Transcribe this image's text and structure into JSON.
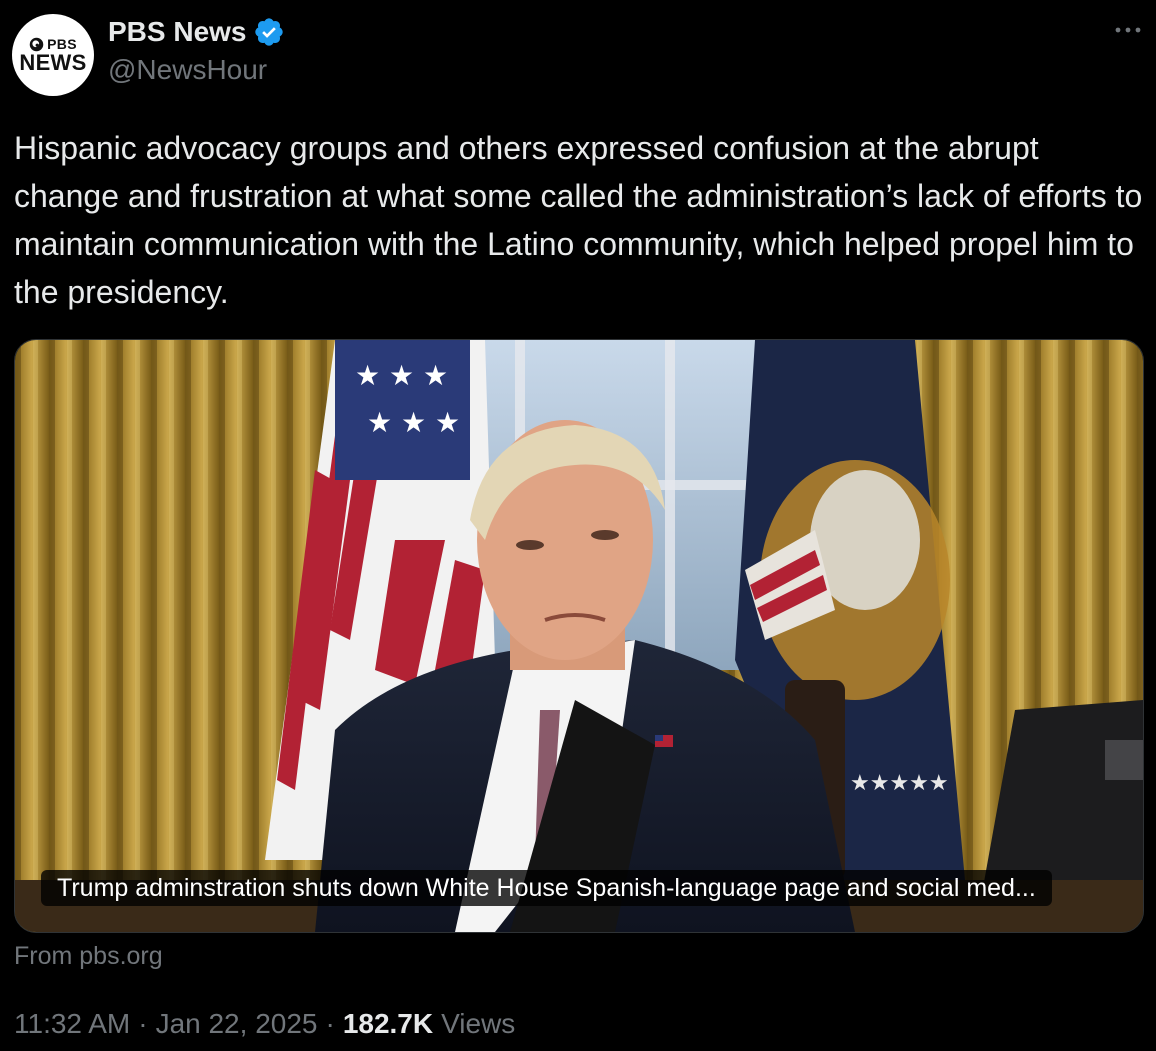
{
  "author": {
    "display_name": "PBS News",
    "handle": "@NewsHour",
    "avatar_logo_top": "PBS",
    "avatar_logo_bottom": "NEWS",
    "verified_icon": "verified-badge-icon"
  },
  "tweet": {
    "text": "Hispanic advocacy groups and others expressed confusion at the abrupt change and frustration at what some called the administration’s lack of efforts to maintain communication with the Latino community, which helped propel him to the presidency."
  },
  "card": {
    "caption": "Trump adminstration shuts down White House Spanish-language page and social med...",
    "source": "From pbs.org"
  },
  "meta": {
    "time": "11:32 AM",
    "separator": "·",
    "date": "Jan 22, 2025",
    "views_count": "182.7K",
    "views_label": "Views"
  },
  "colors": {
    "background": "#000000",
    "text_primary": "#e7e9ea",
    "text_secondary": "#71767b",
    "verified_blue": "#1d9bf0"
  }
}
